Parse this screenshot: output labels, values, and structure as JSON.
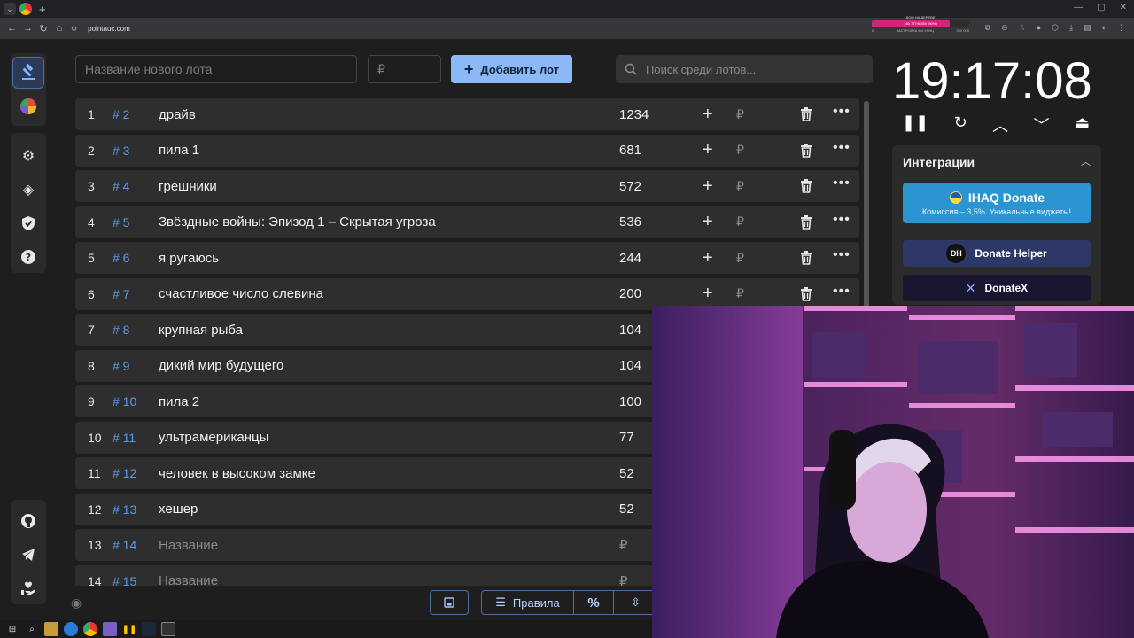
{
  "browser": {
    "url": "pointauc.com",
    "widget_title": "ДОМ НА ДЕРЕВЕ",
    "widget_bar_text": "160 777/6 559 (80%)",
    "widget_progress": 0.8,
    "widget_left": "0",
    "widget_mid": "ЗАСТРОЙКА ВИ УЛИЦ",
    "widget_right": "200 000"
  },
  "toolbar": {
    "new_lot_placeholder": "Название нового лота",
    "price_placeholder": "₽",
    "add_label": "Добавить лот",
    "search_placeholder": "Поиск среди лотов..."
  },
  "lots": [
    {
      "num": "1",
      "id": "# 2",
      "name": "драйв",
      "amount": "1234"
    },
    {
      "num": "2",
      "id": "# 3",
      "name": "пила 1",
      "amount": "681"
    },
    {
      "num": "3",
      "id": "# 4",
      "name": "грешники",
      "amount": "572"
    },
    {
      "num": "4",
      "id": "# 5",
      "name": "Звёздные войны: Эпизод 1 – Скрытая угроза",
      "amount": "536"
    },
    {
      "num": "5",
      "id": "# 6",
      "name": "я ругаюсь",
      "amount": "244"
    },
    {
      "num": "6",
      "id": "# 7",
      "name": "счастливое число слевина",
      "amount": "200"
    },
    {
      "num": "7",
      "id": "# 8",
      "name": "крупная рыба",
      "amount": "104"
    },
    {
      "num": "8",
      "id": "# 9",
      "name": "дикий мир будущего",
      "amount": "104"
    },
    {
      "num": "9",
      "id": "# 10",
      "name": "пила 2",
      "amount": "100"
    },
    {
      "num": "10",
      "id": "# 11",
      "name": "ультрамериканцы",
      "amount": "77"
    },
    {
      "num": "11",
      "id": "# 12",
      "name": "человек в высоком замке",
      "amount": "52"
    },
    {
      "num": "12",
      "id": "# 13",
      "name": "хешер",
      "amount": "52"
    },
    {
      "num": "13",
      "id": "# 14",
      "name": "Название",
      "amount": "₽",
      "placeholder": true
    },
    {
      "num": "14",
      "id": "# 15",
      "name": "Название",
      "amount": "₽",
      "placeholder": true
    }
  ],
  "row_rub": "₽",
  "bottom": {
    "rules_label": "Правила",
    "percent_label": "%"
  },
  "timer": {
    "time": "19:17:08"
  },
  "integrations": {
    "title": "Интеграции",
    "ihaq_name": "IHAQ Donate",
    "ihaq_sub": "Комиссия – 3,5%. Уникальные виджеты!",
    "donate_helper": "Donate Helper",
    "donate_helper_logo": "DH",
    "donatex": "DonateX"
  },
  "colors": {
    "accent": "#8ab9f5",
    "id_blue": "#5a9be8",
    "ihaq": "#2a95d1",
    "donate_helper": "#2d3866"
  }
}
